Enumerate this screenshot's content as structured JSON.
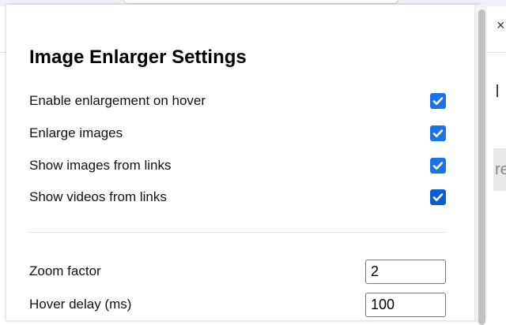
{
  "title": "Image Enlarger Settings",
  "checkboxes": [
    {
      "label": "Enable enlargement on hover",
      "checked": true
    },
    {
      "label": "Enlarge images",
      "checked": true
    },
    {
      "label": "Show images from links",
      "checked": true
    },
    {
      "label": "Show videos from links",
      "checked": true
    }
  ],
  "fields": [
    {
      "label": "Zoom factor",
      "value": "2"
    },
    {
      "label": "Hover delay (ms)",
      "value": "100"
    }
  ],
  "background": {
    "close_glyph": "×",
    "partial_text": "re"
  },
  "accent": "#1a73e8"
}
